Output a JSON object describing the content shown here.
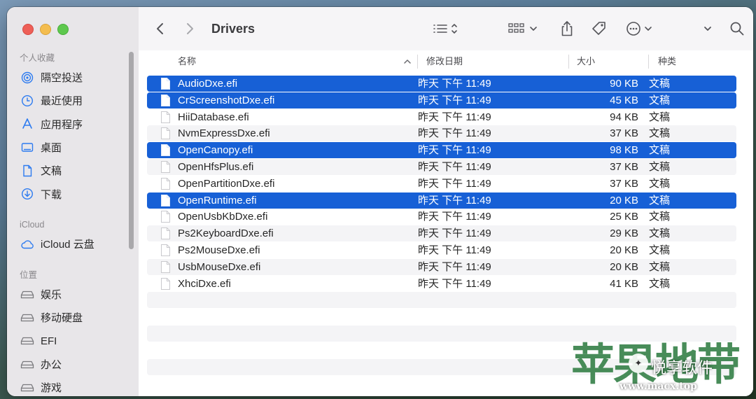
{
  "window": {
    "title": "Drivers"
  },
  "sidebar": {
    "favorites_header": "个人收藏",
    "favorites": [
      {
        "label": "隔空投送",
        "icon": "airdrop-icon"
      },
      {
        "label": "最近使用",
        "icon": "clock-icon"
      },
      {
        "label": "应用程序",
        "icon": "applications-icon"
      },
      {
        "label": "桌面",
        "icon": "desktop-icon"
      },
      {
        "label": "文稿",
        "icon": "document-icon"
      },
      {
        "label": "下载",
        "icon": "download-icon"
      }
    ],
    "icloud_header": "iCloud",
    "icloud": [
      {
        "label": "iCloud 云盘",
        "icon": "cloud-icon"
      }
    ],
    "locations_header": "位置",
    "locations": [
      {
        "label": "娱乐",
        "icon": "disk-icon"
      },
      {
        "label": "移动硬盘",
        "icon": "disk-icon"
      },
      {
        "label": "EFI",
        "icon": "disk-icon"
      },
      {
        "label": "办公",
        "icon": "disk-icon"
      },
      {
        "label": "游戏",
        "icon": "disk-icon"
      }
    ]
  },
  "columns": {
    "name": "名称",
    "date": "修改日期",
    "size": "大小",
    "kind": "种类"
  },
  "files": [
    {
      "name": "AudioDxe.efi",
      "date": "昨天 下午 11:49",
      "size": "90 KB",
      "kind": "文稿",
      "selected": true
    },
    {
      "name": "CrScreenshotDxe.efi",
      "date": "昨天 下午 11:49",
      "size": "45 KB",
      "kind": "文稿",
      "selected": true
    },
    {
      "name": "HiiDatabase.efi",
      "date": "昨天 下午 11:49",
      "size": "94 KB",
      "kind": "文稿",
      "selected": false
    },
    {
      "name": "NvmExpressDxe.efi",
      "date": "昨天 下午 11:49",
      "size": "37 KB",
      "kind": "文稿",
      "selected": false
    },
    {
      "name": "OpenCanopy.efi",
      "date": "昨天 下午 11:49",
      "size": "98 KB",
      "kind": "文稿",
      "selected": true
    },
    {
      "name": "OpenHfsPlus.efi",
      "date": "昨天 下午 11:49",
      "size": "37 KB",
      "kind": "文稿",
      "selected": false
    },
    {
      "name": "OpenPartitionDxe.efi",
      "date": "昨天 下午 11:49",
      "size": "37 KB",
      "kind": "文稿",
      "selected": false
    },
    {
      "name": "OpenRuntime.efi",
      "date": "昨天 下午 11:49",
      "size": "20 KB",
      "kind": "文稿",
      "selected": true
    },
    {
      "name": "OpenUsbKbDxe.efi",
      "date": "昨天 下午 11:49",
      "size": "25 KB",
      "kind": "文稿",
      "selected": false
    },
    {
      "name": "Ps2KeyboardDxe.efi",
      "date": "昨天 下午 11:49",
      "size": "29 KB",
      "kind": "文稿",
      "selected": false
    },
    {
      "name": "Ps2MouseDxe.efi",
      "date": "昨天 下午 11:49",
      "size": "20 KB",
      "kind": "文稿",
      "selected": false
    },
    {
      "name": "UsbMouseDxe.efi",
      "date": "昨天 下午 11:49",
      "size": "20 KB",
      "kind": "文稿",
      "selected": false
    },
    {
      "name": "XhciDxe.efi",
      "date": "昨天 下午 11:49",
      "size": "41 KB",
      "kind": "文稿",
      "selected": false
    }
  ],
  "watermark": {
    "big": "苹果地带",
    "text": "悦享软件",
    "url": "www.macx.top"
  },
  "colors": {
    "selection": "#1760d6",
    "accent": "#2d7bf0"
  }
}
